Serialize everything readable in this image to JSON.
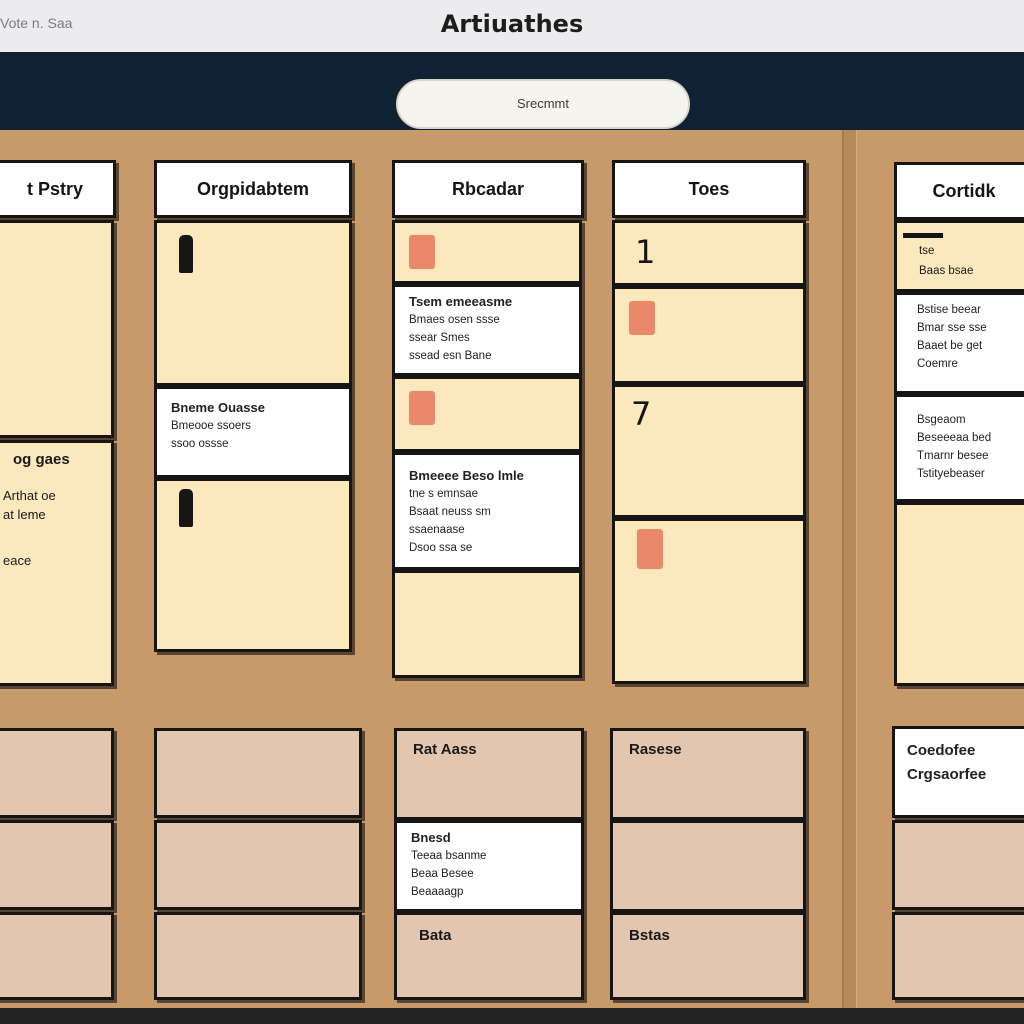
{
  "window": {
    "left_text": "Vote n. Saa",
    "title": "Artiuathes"
  },
  "search": {
    "label": "Srecmmt"
  },
  "columns": {
    "col1": {
      "header": "t Pstry",
      "note_title": "og gaes",
      "note_lines": [
        "Arthat oe",
        "at leme",
        "eace"
      ]
    },
    "col2": {
      "header": "Orgpidabtem",
      "card_lines": [
        "Bneme Ouasse",
        "Bmeooe ssoers",
        "ssoo ossse"
      ]
    },
    "col3": {
      "header": "Rbcadar",
      "card1_lines": [
        "Tsem emeeasme",
        "Bmaes osen ssse",
        "ssear Smes",
        "ssead esn Bane"
      ],
      "card2_lines": [
        "Bmeeee Beso lmle",
        "tne s emnsae",
        "Bsaat neuss sm",
        "ssaenaase",
        "Dsoo ssa se"
      ]
    },
    "col4": {
      "header": "Toes",
      "num1": "1",
      "num2": "7"
    },
    "col5": {
      "header": "Cortidk",
      "card0_lines": [
        "tse",
        "Baas bsae"
      ],
      "card1_lines": [
        "Bstise beear",
        "Bmar sse sse",
        "Baaet be get",
        "Coemre"
      ],
      "card2_lines": [
        "Bsgeaom",
        "Beseeeaa bed",
        "Tmarnr besee",
        "Tstityebeaser"
      ]
    }
  },
  "bottom": {
    "c3_label": "Rat Aass",
    "c3_card_title": "Bnesd",
    "c3_card_lines": [
      "Teeaa bsanme",
      "Beaa Besee",
      "Beaaaagp"
    ],
    "c3_bottom_label": "Bata",
    "c4_label": "Rasese",
    "c4_bottom_label": "Bstas",
    "c5_card_lines": [
      "Coedofee",
      "Crgsaorfee"
    ]
  },
  "colors": {
    "board": "#c89a6a",
    "navbar": "#0f2233",
    "note": "#fbe8bd",
    "bottom_card": "#e2c6b0",
    "swatch": "#e9896a",
    "card": "#ffffff"
  },
  "icons": [
    "person-figure-icon",
    "color-swatch-icon"
  ]
}
